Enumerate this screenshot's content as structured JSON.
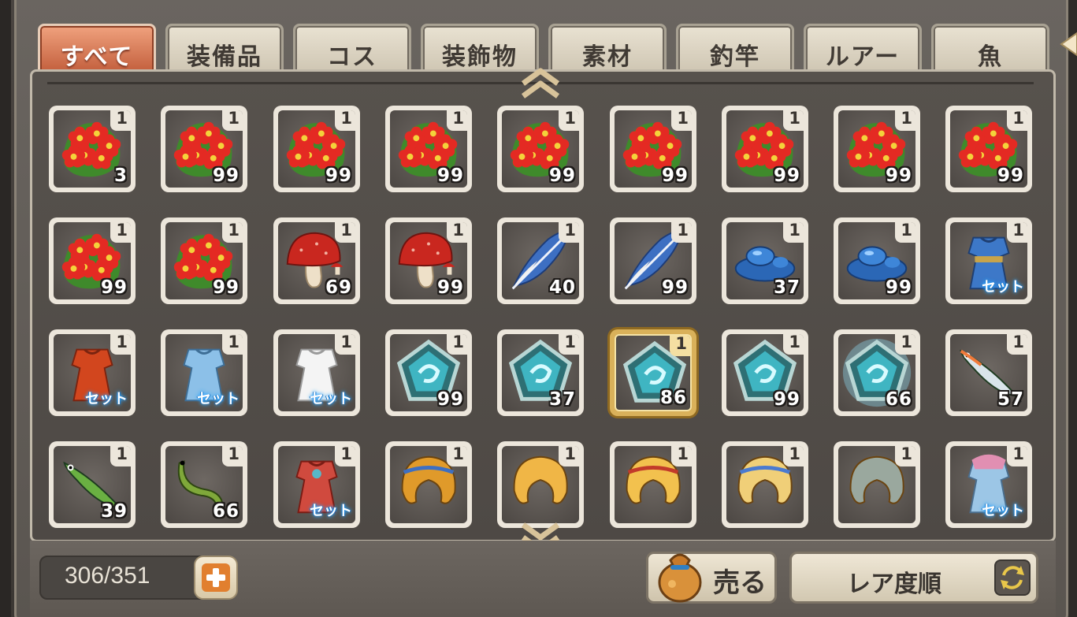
{
  "tabs": [
    {
      "label": "すべて",
      "active": true
    },
    {
      "label": "装備品",
      "active": false
    },
    {
      "label": "コス",
      "active": false
    },
    {
      "label": "装飾物",
      "active": false
    },
    {
      "label": "素材",
      "active": false
    },
    {
      "label": "釣竿",
      "active": false
    },
    {
      "label": "ルアー",
      "active": false
    },
    {
      "label": "魚",
      "active": false
    }
  ],
  "items": [
    {
      "icon": "red-flower-icon",
      "rank": "1",
      "count": "3",
      "selected": false
    },
    {
      "icon": "red-flower-icon",
      "rank": "1",
      "count": "99",
      "selected": false
    },
    {
      "icon": "red-flower-icon",
      "rank": "1",
      "count": "99",
      "selected": false
    },
    {
      "icon": "red-flower-icon",
      "rank": "1",
      "count": "99",
      "selected": false
    },
    {
      "icon": "red-flower-icon",
      "rank": "1",
      "count": "99",
      "selected": false
    },
    {
      "icon": "red-flower-icon",
      "rank": "1",
      "count": "99",
      "selected": false
    },
    {
      "icon": "red-flower-icon",
      "rank": "1",
      "count": "99",
      "selected": false
    },
    {
      "icon": "red-flower-icon",
      "rank": "1",
      "count": "99",
      "selected": false
    },
    {
      "icon": "red-flower-icon",
      "rank": "1",
      "count": "99",
      "selected": false
    },
    {
      "icon": "red-flower-icon",
      "rank": "1",
      "count": "99",
      "selected": false
    },
    {
      "icon": "red-flower-icon",
      "rank": "1",
      "count": "99",
      "selected": false
    },
    {
      "icon": "red-mushroom-icon",
      "rank": "1",
      "count": "69",
      "selected": false
    },
    {
      "icon": "red-mushroom-icon",
      "rank": "1",
      "count": "99",
      "selected": false
    },
    {
      "icon": "blue-feather-icon",
      "rank": "1",
      "count": "40",
      "selected": false
    },
    {
      "icon": "blue-feather-icon",
      "rank": "1",
      "count": "99",
      "selected": false
    },
    {
      "icon": "blue-slime-icon",
      "rank": "1",
      "count": "37",
      "selected": false
    },
    {
      "icon": "blue-slime-icon",
      "rank": "1",
      "count": "99",
      "selected": false
    },
    {
      "icon": "blue-armor-set-icon",
      "rank": "1",
      "set": "セット",
      "selected": false
    },
    {
      "icon": "red-dress-set-icon",
      "rank": "1",
      "set": "セット",
      "selected": false
    },
    {
      "icon": "blue-dress-set-icon",
      "rank": "1",
      "set": "セット",
      "selected": false
    },
    {
      "icon": "white-dress-set-icon",
      "rank": "1",
      "set": "セット",
      "selected": false
    },
    {
      "icon": "teal-pentagon-gem-icon",
      "rank": "1",
      "count": "99",
      "selected": false
    },
    {
      "icon": "teal-pentagon-gem-icon",
      "rank": "1",
      "count": "37",
      "selected": false
    },
    {
      "icon": "teal-pentagon-gem-icon",
      "rank": "1",
      "count": "86",
      "selected": true
    },
    {
      "icon": "teal-pentagon-gem-icon",
      "rank": "1",
      "count": "99",
      "selected": false
    },
    {
      "icon": "teal-pentagon-gem-glow-icon",
      "rank": "1",
      "count": "66",
      "selected": false
    },
    {
      "icon": "silver-lure-icon",
      "rank": "1",
      "count": "57",
      "selected": false
    },
    {
      "icon": "green-lure-icon",
      "rank": "1",
      "count": "39",
      "selected": false
    },
    {
      "icon": "green-worm-lure-icon",
      "rank": "1",
      "count": "66",
      "selected": false
    },
    {
      "icon": "red-outfit-set-icon",
      "rank": "1",
      "set": "セット",
      "selected": false
    },
    {
      "icon": "orange-hair-icon",
      "rank": "1",
      "selected": false
    },
    {
      "icon": "blonde-hair-icon",
      "rank": "1",
      "selected": false
    },
    {
      "icon": "blonde-hair-hat-icon",
      "rank": "1",
      "selected": false
    },
    {
      "icon": "blonde-short-hair-icon",
      "rank": "1",
      "selected": false
    },
    {
      "icon": "gray-hair-icon",
      "rank": "1",
      "selected": false
    },
    {
      "icon": "pink-blue-dress-set-icon",
      "rank": "1",
      "set": "セット",
      "selected": false
    }
  ],
  "capacity": {
    "text": "306/351",
    "add_icon": "plus-icon"
  },
  "sell_button": {
    "label": "売る",
    "icon": "money-bag-icon"
  },
  "sort_button": {
    "label": "レア度順",
    "icon": "swap-arrows-icon"
  },
  "scroll": {
    "up_icon": "double-chevron-up-icon",
    "down_icon": "double-chevron-down-icon"
  },
  "colors": {
    "active_tab": "#d9714a",
    "selected_border": "#d9b15a",
    "plus_accent": "#e17f2f"
  }
}
